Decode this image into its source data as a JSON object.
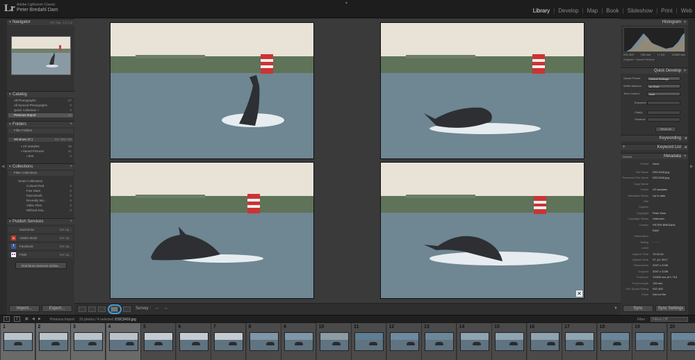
{
  "app": {
    "product": "Adobe Lightroom Classic",
    "user": "Peter Bredahl Dam",
    "logo": "Lr"
  },
  "modules": [
    "Library",
    "Develop",
    "Map",
    "Book",
    "Slideshow",
    "Print",
    "Web"
  ],
  "active_module": "Library",
  "navigator": {
    "title": "Navigator",
    "zoom": [
      "FIT",
      "FILL",
      "1:1",
      "1:2"
    ]
  },
  "catalog": {
    "title": "Catalog",
    "items": [
      {
        "label": "All Photographs",
        "count": "57"
      },
      {
        "label": "All Synced Photographs",
        "count": "0"
      },
      {
        "label": "Quick Collection +",
        "count": "0"
      },
      {
        "label": "Previous Import",
        "count": "20"
      }
    ]
  },
  "folders": {
    "title": "Folders",
    "filter": "Filter Folders",
    "volume": "Windows (C:)",
    "volume_space": "60 / 952 GB",
    "items": [
      {
        "label": "LR samples",
        "count": "35"
      },
      {
        "label": "Saved Pictures",
        "count": "41"
      },
      {
        "label": "test",
        "count": "2"
      }
    ]
  },
  "collections": {
    "title": "Collections",
    "filter": "Filter Collections",
    "group": "Smart Collections",
    "items": [
      {
        "label": "Colored Red",
        "count": "0"
      },
      {
        "label": "Five Stars",
        "count": "0"
      },
      {
        "label": "Past Month",
        "count": "0"
      },
      {
        "label": "Recently Mo...",
        "count": "0"
      },
      {
        "label": "Video Files",
        "count": "0"
      },
      {
        "label": "Without Key...",
        "count": "0"
      }
    ]
  },
  "publish": {
    "title": "Publish Services",
    "items": [
      {
        "label": "Hard Drive",
        "action": "Set Up..."
      },
      {
        "label": "Adobe Stock",
        "action": "Set Up..."
      },
      {
        "label": "Facebook",
        "action": "Set Up..."
      },
      {
        "label": "Flickr",
        "action": "Set Up..."
      }
    ],
    "find_more": "Find More Services Online..."
  },
  "left_buttons": {
    "import": "Import...",
    "export": "Export..."
  },
  "right": {
    "histogram": "Histogram",
    "hist_info": [
      "ISO 400",
      "135 mm",
      "f / 5.6",
      "1/1600 sec"
    ],
    "hist_caption": "Original + Smart Preview",
    "quick_develop": "Quick Develop",
    "qd_rows": [
      {
        "k": "Saved Preset",
        "v": "Default Settings"
      },
      {
        "k": "White Balance",
        "v": "As Shot"
      },
      {
        "k": "Tone Control",
        "v": "Auto"
      }
    ],
    "qd_sliders": [
      "Exposure",
      "Clarity",
      "Vibrance"
    ],
    "reset_all": "Reset All",
    "keywording": "Keywording",
    "keyword_list": "Keyword List",
    "metadata": "Metadata",
    "meta_default": "Default",
    "preset_label": "Preset",
    "preset_value": "None",
    "meta": [
      {
        "k": "File Name",
        "v": "DSC3416.jpg"
      },
      {
        "k": "Preserved File Name",
        "v": "DSC3416.jpg"
      },
      {
        "k": "Copy Name",
        "v": ""
      },
      {
        "k": "Folder",
        "v": "LR samples"
      },
      {
        "k": "Metadata Status",
        "v": "Up to date"
      },
      {
        "k": "Title",
        "v": ""
      },
      {
        "k": "Caption",
        "v": ""
      },
      {
        "k": "Copyright",
        "v": "Peter Dam"
      },
      {
        "k": "Copyright Status",
        "v": "Unknown"
      },
      {
        "k": "Creator",
        "v": "PETER BREDAHL"
      },
      {
        "k": "",
        "v": "DAM"
      },
      {
        "k": "Sublocation",
        "v": ""
      },
      {
        "k": "Rating",
        "v": "· · · · ·"
      },
      {
        "k": "Label",
        "v": ""
      },
      {
        "k": "Capture Time",
        "v": "19:22:44"
      },
      {
        "k": "Capture Date",
        "v": "27. jul. 2017"
      },
      {
        "k": "Dimensions",
        "v": "3297 x 2198"
      },
      {
        "k": "Cropped",
        "v": "3297 x 2198"
      },
      {
        "k": "Exposure",
        "v": "1/1600 sec at f / 5.6"
      },
      {
        "k": "Focal Length",
        "v": "135 mm"
      },
      {
        "k": "ISO Speed Rating",
        "v": "ISO 400"
      },
      {
        "k": "Flash",
        "v": "Did not fire"
      }
    ],
    "sync": "Sync",
    "sync_settings": "Sync Settings"
  },
  "toolbar": {
    "sort_label": "Survey :"
  },
  "filmbar": {
    "pages": [
      "1",
      "2"
    ],
    "source": "Previous Import",
    "info": "20 photos / 4 selected /",
    "file": "DSC3416.jpg",
    "filter_label": "Filter :",
    "filter_value": "Filters Off"
  },
  "film_numbers": [
    "1",
    "2",
    "3",
    "4",
    "5",
    "6",
    "7",
    "8",
    "9",
    "10",
    "11",
    "12",
    "13",
    "14",
    "15",
    "16",
    "17",
    "18",
    "19",
    "20"
  ]
}
